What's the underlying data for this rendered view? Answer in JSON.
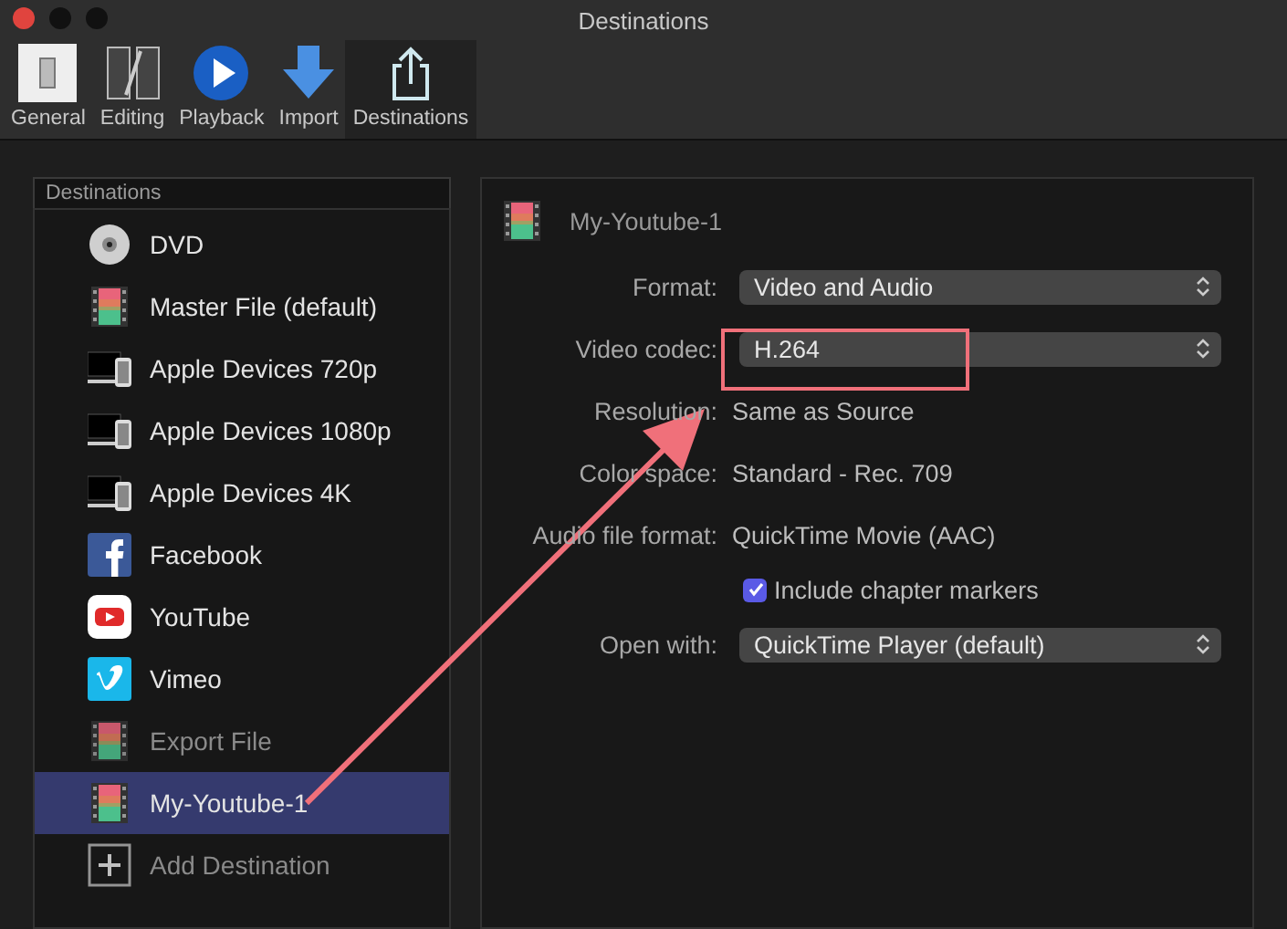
{
  "window": {
    "title": "Destinations"
  },
  "toolbar": [
    {
      "label": "General",
      "selected": false
    },
    {
      "label": "Editing",
      "selected": false
    },
    {
      "label": "Playback",
      "selected": false
    },
    {
      "label": "Import",
      "selected": false
    },
    {
      "label": "Destinations",
      "selected": true
    }
  ],
  "sidebar": {
    "header": "Destinations",
    "items": [
      {
        "label": "DVD",
        "kind": "disc",
        "selected": false,
        "disabled": false
      },
      {
        "label": "Master File (default)",
        "kind": "film",
        "selected": false,
        "disabled": false
      },
      {
        "label": "Apple Devices 720p",
        "kind": "devices",
        "selected": false,
        "disabled": false
      },
      {
        "label": "Apple Devices 1080p",
        "kind": "devices",
        "selected": false,
        "disabled": false
      },
      {
        "label": "Apple Devices 4K",
        "kind": "devices",
        "selected": false,
        "disabled": false
      },
      {
        "label": "Facebook",
        "kind": "facebook",
        "selected": false,
        "disabled": false
      },
      {
        "label": "YouTube",
        "kind": "youtube",
        "selected": false,
        "disabled": false
      },
      {
        "label": "Vimeo",
        "kind": "vimeo",
        "selected": false,
        "disabled": false
      },
      {
        "label": "Export File",
        "kind": "film",
        "selected": false,
        "disabled": true
      },
      {
        "label": "My-Youtube-1",
        "kind": "film",
        "selected": true,
        "disabled": false
      },
      {
        "label": "Add Destination",
        "kind": "add",
        "selected": false,
        "disabled": true
      }
    ]
  },
  "detail": {
    "title": "My-Youtube-1",
    "rows": [
      {
        "kind": "select",
        "label": "Format:",
        "value": "Video and Audio"
      },
      {
        "kind": "select",
        "label": "Video codec:",
        "value": "H.264"
      },
      {
        "kind": "text",
        "label": "Resolution:",
        "value": "Same as Source"
      },
      {
        "kind": "text",
        "label": "Color space:",
        "value": "Standard - Rec. 709"
      },
      {
        "kind": "text",
        "label": "Audio file format:",
        "value": "QuickTime Movie (AAC)"
      },
      {
        "kind": "checkbox",
        "label": "Include chapter markers",
        "checked": true
      },
      {
        "kind": "select",
        "label": "Open with:",
        "value": "QuickTime Player (default)"
      }
    ]
  }
}
